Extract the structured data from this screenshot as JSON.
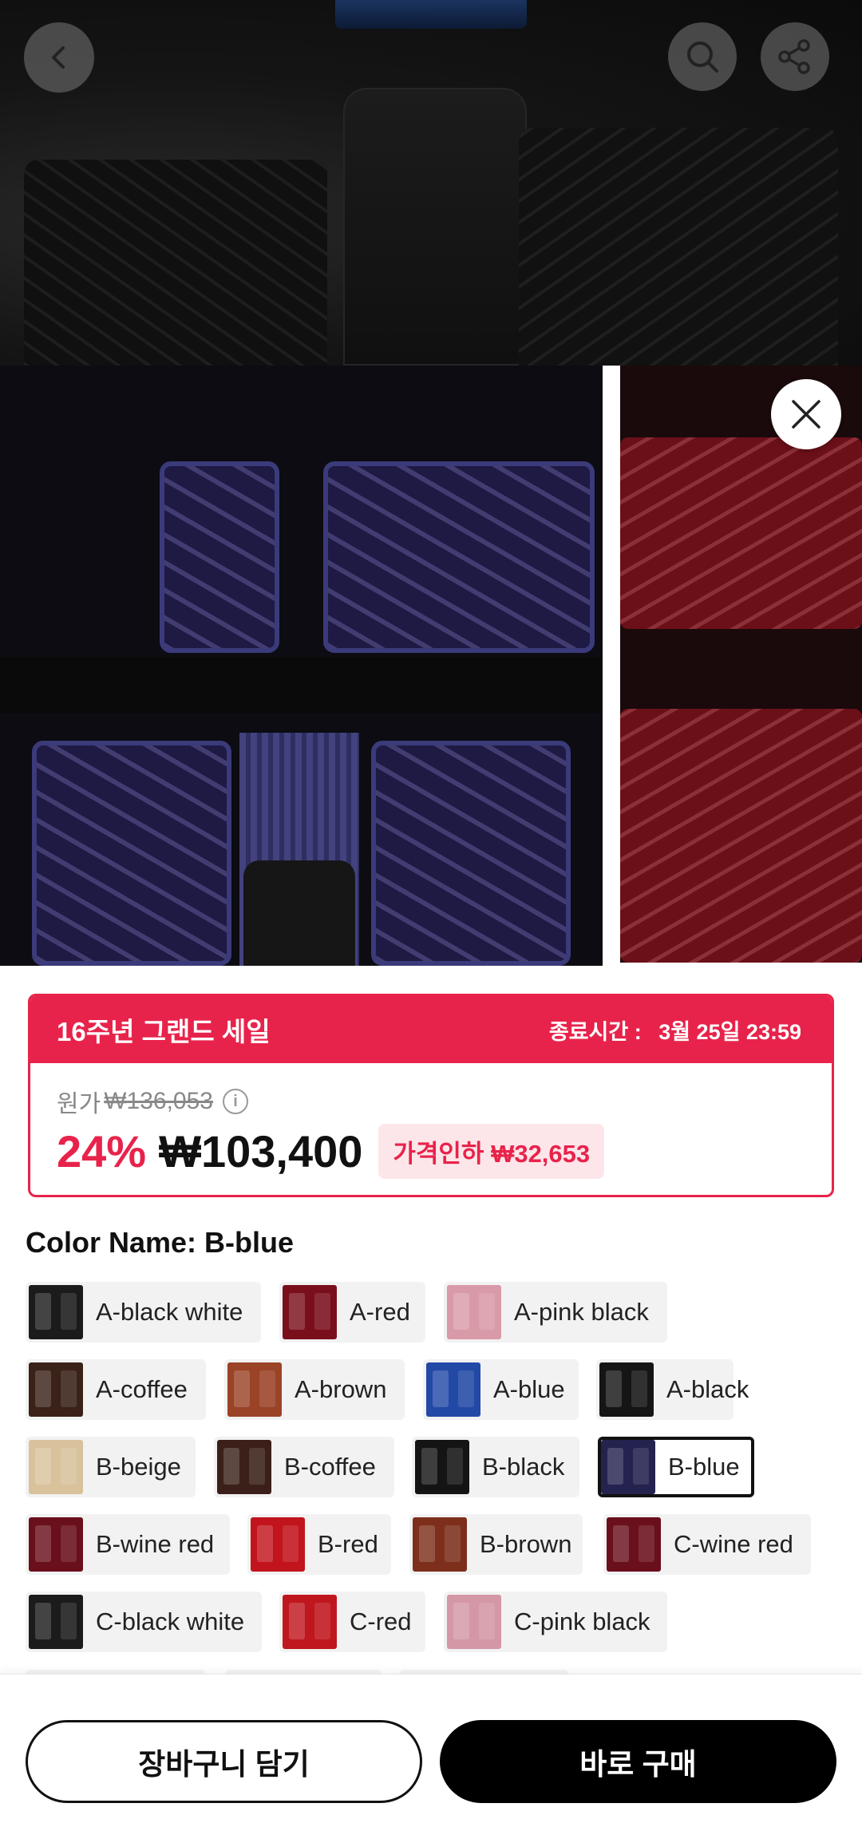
{
  "sale": {
    "title": "16주년 그랜드 세일",
    "end_label": "종료시간 :",
    "end_time": "3월 25일 23:59",
    "original_label": "원가",
    "original_price": "₩136,053",
    "discount": "24%",
    "price": "₩103,400",
    "price_cut_label": "가격인하 ₩32,653",
    "accent_color": "#e8234b"
  },
  "options": {
    "title": "Color Name: B-blue",
    "selected": "B-blue",
    "items": [
      {
        "label": "A-black white",
        "swatch": "#1b1b1b"
      },
      {
        "label": "A-red",
        "swatch": "#7a0f1c"
      },
      {
        "label": "A-pink black",
        "swatch": "#d99aa8"
      },
      {
        "label": "A-coffee",
        "swatch": "#3a2218"
      },
      {
        "label": "A-brown",
        "swatch": "#9a4326"
      },
      {
        "label": "A-blue",
        "swatch": "#2349a6"
      },
      {
        "label": "A-black",
        "swatch": "#151515"
      },
      {
        "label": "B-beige",
        "swatch": "#d8c29c"
      },
      {
        "label": "B-coffee",
        "swatch": "#3b2019"
      },
      {
        "label": "B-black",
        "swatch": "#141414"
      },
      {
        "label": "B-blue",
        "swatch": "#24224e"
      },
      {
        "label": "B-wine red",
        "swatch": "#6a0f1c"
      },
      {
        "label": "B-red",
        "swatch": "#c2141c"
      },
      {
        "label": "B-brown",
        "swatch": "#7d2f1c"
      },
      {
        "label": "C-wine red",
        "swatch": "#6a0f1c"
      },
      {
        "label": "C-black white",
        "swatch": "#1b1b1b"
      },
      {
        "label": "C-red",
        "swatch": "#c0161e"
      },
      {
        "label": "C-pink black",
        "swatch": "#d497a6"
      }
    ]
  },
  "actions": {
    "cart_label": "장바구니 담기",
    "buy_label": "바로 구매"
  },
  "icons": {
    "back": "chevron-left-icon",
    "search": "search-icon",
    "share": "share-icon",
    "close": "close-icon",
    "info": "info-icon"
  }
}
